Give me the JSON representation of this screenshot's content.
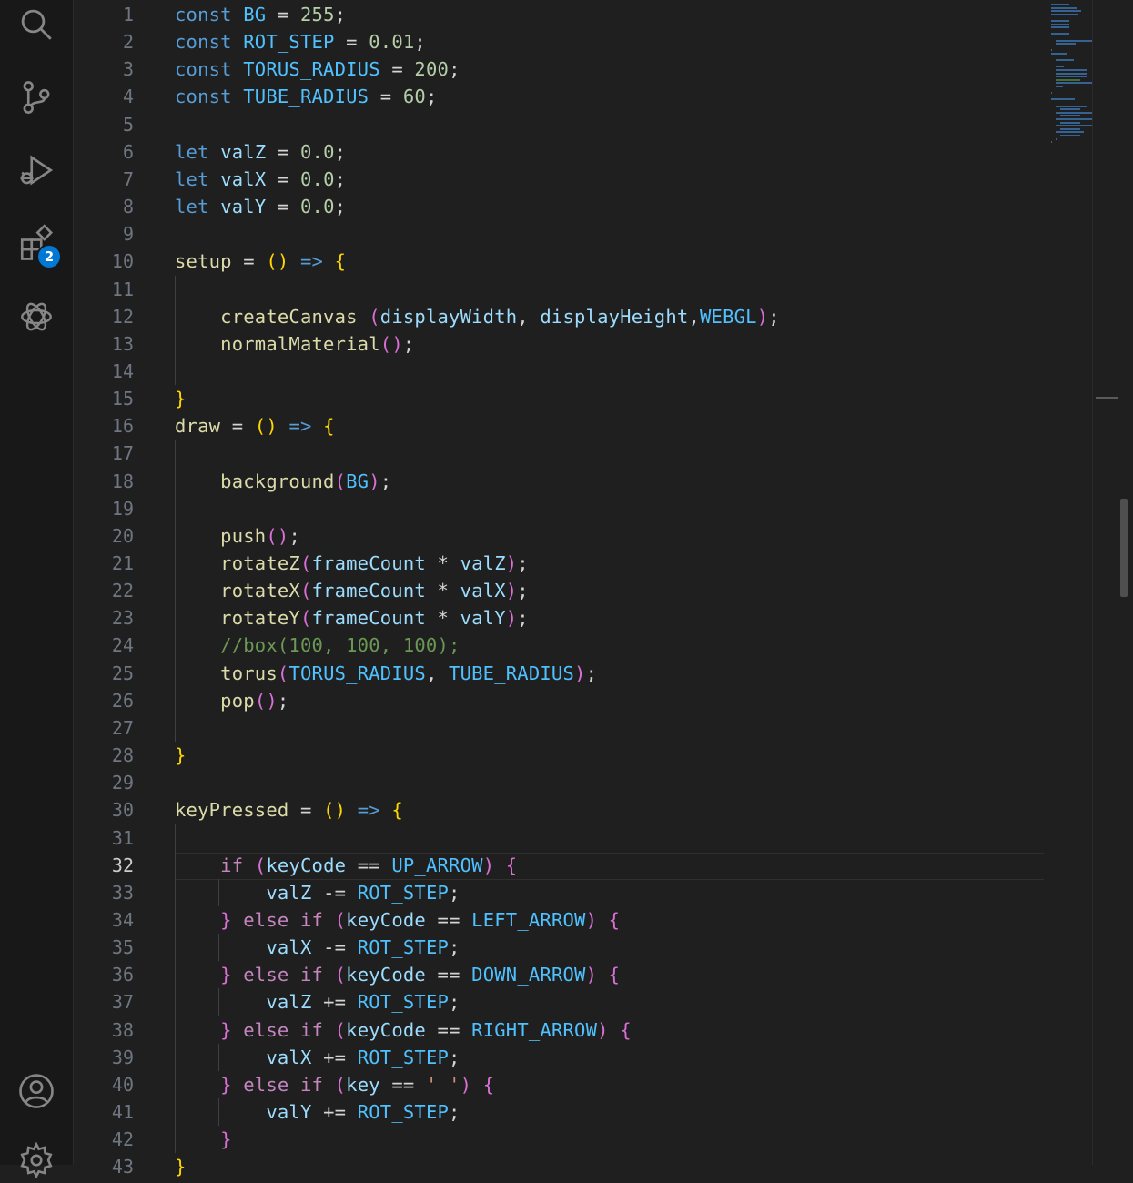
{
  "activity_bar": {
    "items": [
      {
        "name": "search",
        "icon": "search-icon"
      },
      {
        "name": "source-control",
        "icon": "source-control-icon"
      },
      {
        "name": "run-and-debug",
        "icon": "run-debug-icon"
      },
      {
        "name": "extensions",
        "icon": "extensions-icon",
        "badge": "2"
      },
      {
        "name": "chatgpt",
        "icon": "openai-icon"
      },
      {
        "name": "accounts",
        "icon": "account-icon"
      },
      {
        "name": "manage",
        "icon": "gear-icon"
      }
    ],
    "extensions_badge": "2"
  },
  "editor": {
    "language": "javascript",
    "active_line": 32,
    "line_numbers": [
      "1",
      "2",
      "3",
      "4",
      "5",
      "6",
      "7",
      "8",
      "9",
      "10",
      "11",
      "12",
      "13",
      "14",
      "15",
      "16",
      "17",
      "18",
      "19",
      "20",
      "21",
      "22",
      "23",
      "24",
      "25",
      "26",
      "27",
      "28",
      "29",
      "30",
      "31",
      "32",
      "33",
      "34",
      "35",
      "36",
      "37",
      "38",
      "39",
      "40",
      "41",
      "42",
      "43"
    ],
    "lines": [
      "const BG = 255;",
      "const ROT_STEP = 0.01;",
      "const TORUS_RADIUS = 200;",
      "const TUBE_RADIUS = 60;",
      "",
      "let valZ = 0.0;",
      "let valX = 0.0;",
      "let valY = 0.0;",
      "",
      "setup = () => {",
      "",
      "    createCanvas (displayWidth, displayHeight,WEBGL);",
      "    normalMaterial();",
      "",
      "}",
      "draw = () => {",
      "",
      "    background(BG);",
      "",
      "    push();",
      "    rotateZ(frameCount * valZ);",
      "    rotateX(frameCount * valX);",
      "    rotateY(frameCount * valY);",
      "    //box(100, 100, 100);",
      "    torus(TORUS_RADIUS, TUBE_RADIUS);",
      "    pop();",
      "",
      "}",
      "",
      "keyPressed = () => {",
      "",
      "    if (keyCode == UP_ARROW) {",
      "        valZ -= ROT_STEP;",
      "    } else if (keyCode == LEFT_ARROW) {",
      "        valX -= ROT_STEP;",
      "    } else if (keyCode == DOWN_ARROW) {",
      "        valZ += ROT_STEP;",
      "    } else if (keyCode == RIGHT_ARROW) {",
      "        valX += ROT_STEP;",
      "    } else if (key == ' ') {",
      "        valY += ROT_STEP;",
      "    }",
      "}"
    ]
  },
  "colors": {
    "background": "#1f1f1f",
    "activity_bar": "#181818",
    "keyword": "#569cd6",
    "control": "#c586c0",
    "constant": "#4fc1ff",
    "variable": "#9cdcfe",
    "function": "#dcdcaa",
    "number": "#b5cea8",
    "string": "#ce9178",
    "comment": "#6a9955",
    "badge": "#0078d4"
  }
}
